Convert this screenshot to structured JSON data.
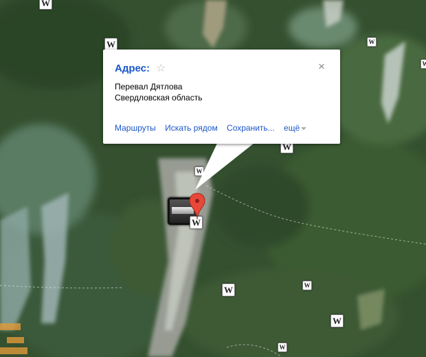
{
  "map": {
    "type": "satellite",
    "marker_icon": "red-map-pin-icon",
    "photo_icon": "photo-thumbnail-icon",
    "wikipedia_icon": "wikipedia-w-icon",
    "wikipedia_label": "W"
  },
  "info_window": {
    "title": "Адрес:",
    "star_icon": "☆",
    "close_icon": "×",
    "address_line1": "Перевал Дятлова",
    "address_line2": "Свердловская область",
    "links": {
      "routes": "Маршруты",
      "search_nearby": "Искать рядом",
      "save": "Сохранить...",
      "more": "ещё"
    },
    "link_color": "#1a56c9"
  }
}
